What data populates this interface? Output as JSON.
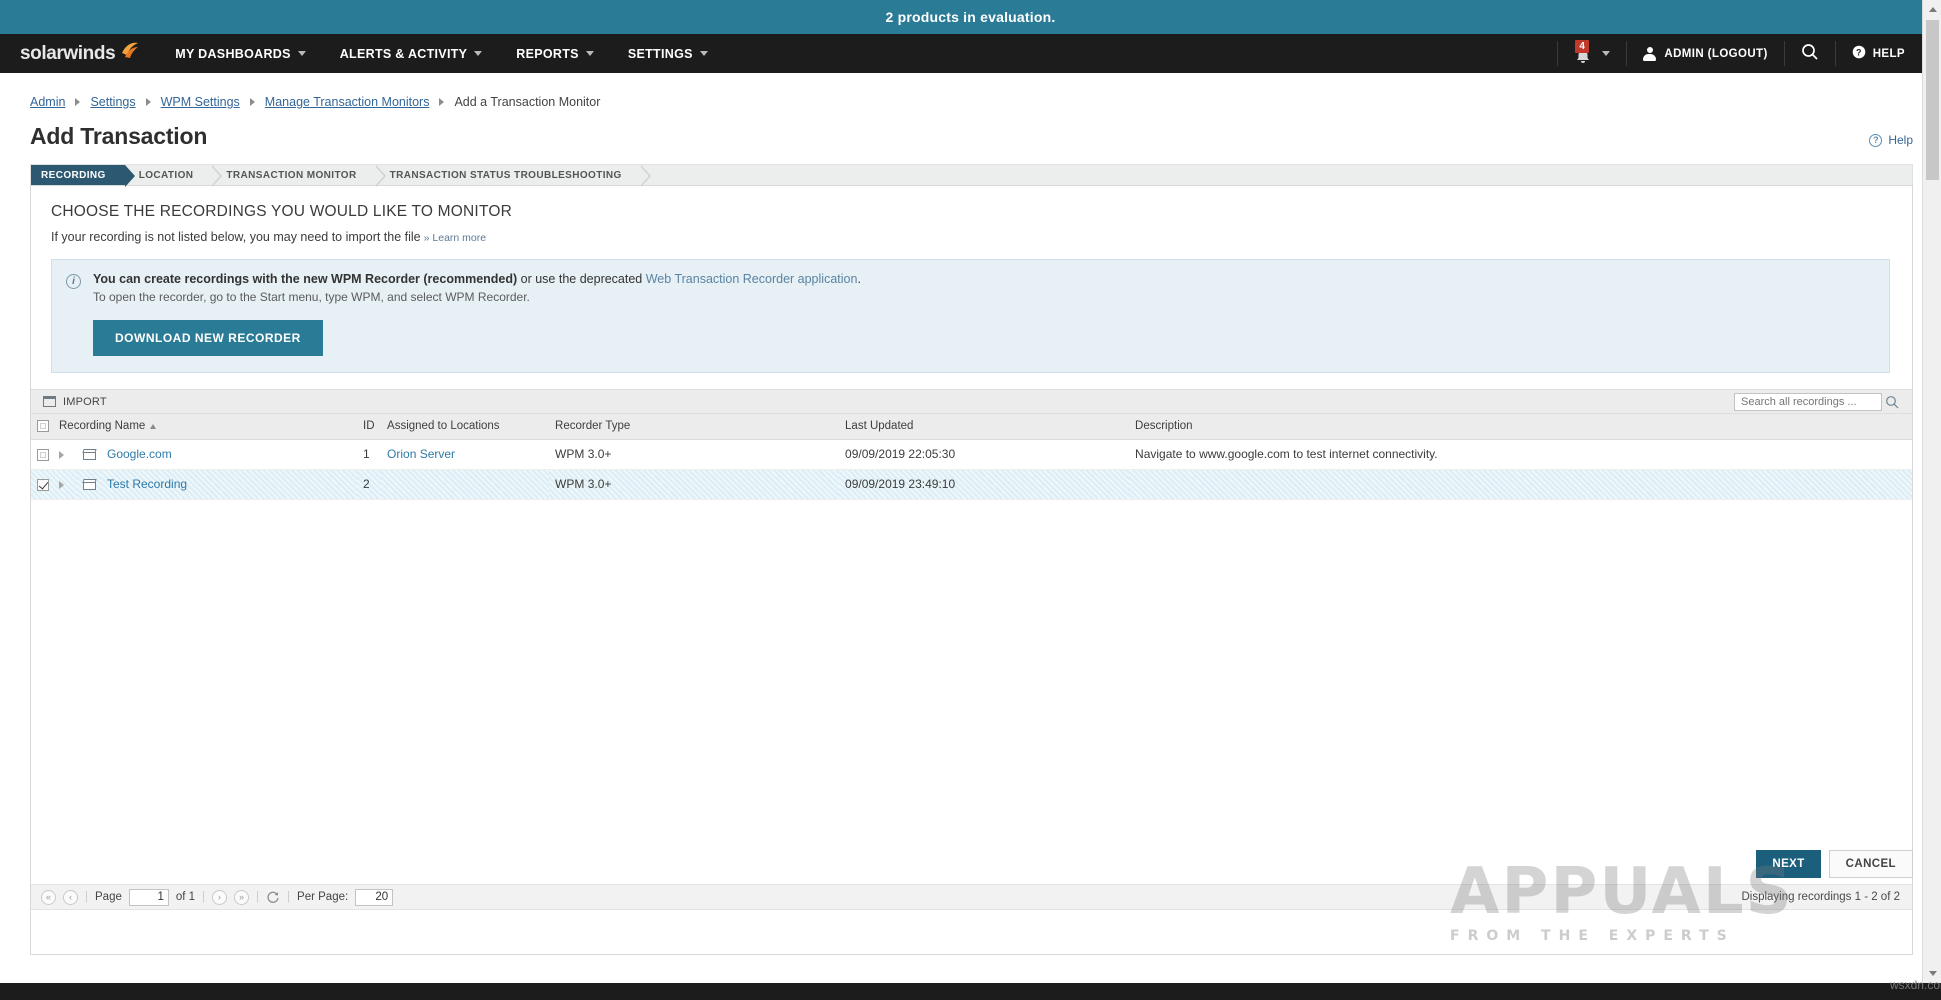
{
  "eval_banner": {
    "text": "2 products in evaluation."
  },
  "topnav": {
    "brand": "solarwinds",
    "items": [
      {
        "label": "MY DASHBOARDS"
      },
      {
        "label": "ALERTS & ACTIVITY"
      },
      {
        "label": "REPORTS"
      },
      {
        "label": "SETTINGS"
      }
    ],
    "notifications": {
      "icon": "bell-icon",
      "count": "4"
    },
    "account": {
      "icon": "person-icon",
      "label": "ADMIN (LOGOUT)"
    },
    "search": {
      "icon": "search-icon"
    },
    "help": {
      "icon": "question-circle-icon",
      "label": "HELP"
    }
  },
  "breadcrumb": {
    "items": [
      {
        "label": "Admin",
        "link": true
      },
      {
        "label": "Settings",
        "link": true
      },
      {
        "label": "WPM Settings",
        "link": true
      },
      {
        "label": "Manage Transaction Monitors",
        "link": true
      },
      {
        "label": "Add a Transaction Monitor",
        "link": false
      }
    ]
  },
  "page": {
    "title": "Add Transaction",
    "help_label": "Help"
  },
  "steps": [
    {
      "label": "RECORDING",
      "active": true
    },
    {
      "label": "LOCATION",
      "active": false
    },
    {
      "label": "TRANSACTION MONITOR",
      "active": false
    },
    {
      "label": "TRANSACTION STATUS TROUBLESHOOTING",
      "active": false
    }
  ],
  "section": {
    "title": "CHOOSE THE RECORDINGS YOU WOULD LIKE TO MONITOR",
    "subtitle": "If your recording is not listed below, you may need to import the file",
    "learn_more": "» Learn more"
  },
  "infobox": {
    "line1_bold": "You can create recordings with the new WPM Recorder (recommended)",
    "line1_mid": " or use the deprecated ",
    "line1_link": "Web Transaction Recorder application",
    "line1_end": ".",
    "line2": "To open the recorder, go to the Start menu, type WPM, and select WPM Recorder.",
    "download_button": "DOWNLOAD NEW RECORDER"
  },
  "toolbar": {
    "import_label": "IMPORT",
    "search_placeholder": "Search all recordings ...",
    "search_value": ""
  },
  "table": {
    "columns": [
      {
        "label": "Recording Name",
        "sorted": "asc"
      },
      {
        "label": "ID"
      },
      {
        "label": "Assigned to Locations"
      },
      {
        "label": "Recorder Type"
      },
      {
        "label": "Last Updated"
      },
      {
        "label": "Description"
      }
    ],
    "rows": [
      {
        "checked": false,
        "selected": false,
        "name": "Google.com",
        "id": "1",
        "assigned": "Orion Server",
        "recorder_type": "WPM 3.0+",
        "last_updated": "09/09/2019 22:05:30",
        "description": "Navigate to www.google.com to test internet connectivity."
      },
      {
        "checked": true,
        "selected": true,
        "name": "Test Recording",
        "id": "2",
        "assigned": "",
        "recorder_type": "WPM 3.0+",
        "last_updated": "09/09/2019 23:49:10",
        "description": ""
      }
    ]
  },
  "pager": {
    "page_label": "Page",
    "page_value": "1",
    "of_label": "of 1",
    "per_page_label": "Per Page:",
    "per_page_value": "20",
    "displaying": "Displaying recordings 1 - 2 of 2"
  },
  "actions": {
    "next": "NEXT",
    "cancel": "CANCEL"
  },
  "watermark": {
    "title": "APPUALS",
    "subtitle": "FROM THE EXPERTS",
    "domain": "wsxdn.com"
  },
  "colors": {
    "brand_teal": "#2a7b96",
    "nav_black": "#1c1c1c",
    "step_active": "#2c5871",
    "link_blue": "#336699",
    "row_selected": "#dceef5",
    "next_button": "#1b5f7d"
  }
}
